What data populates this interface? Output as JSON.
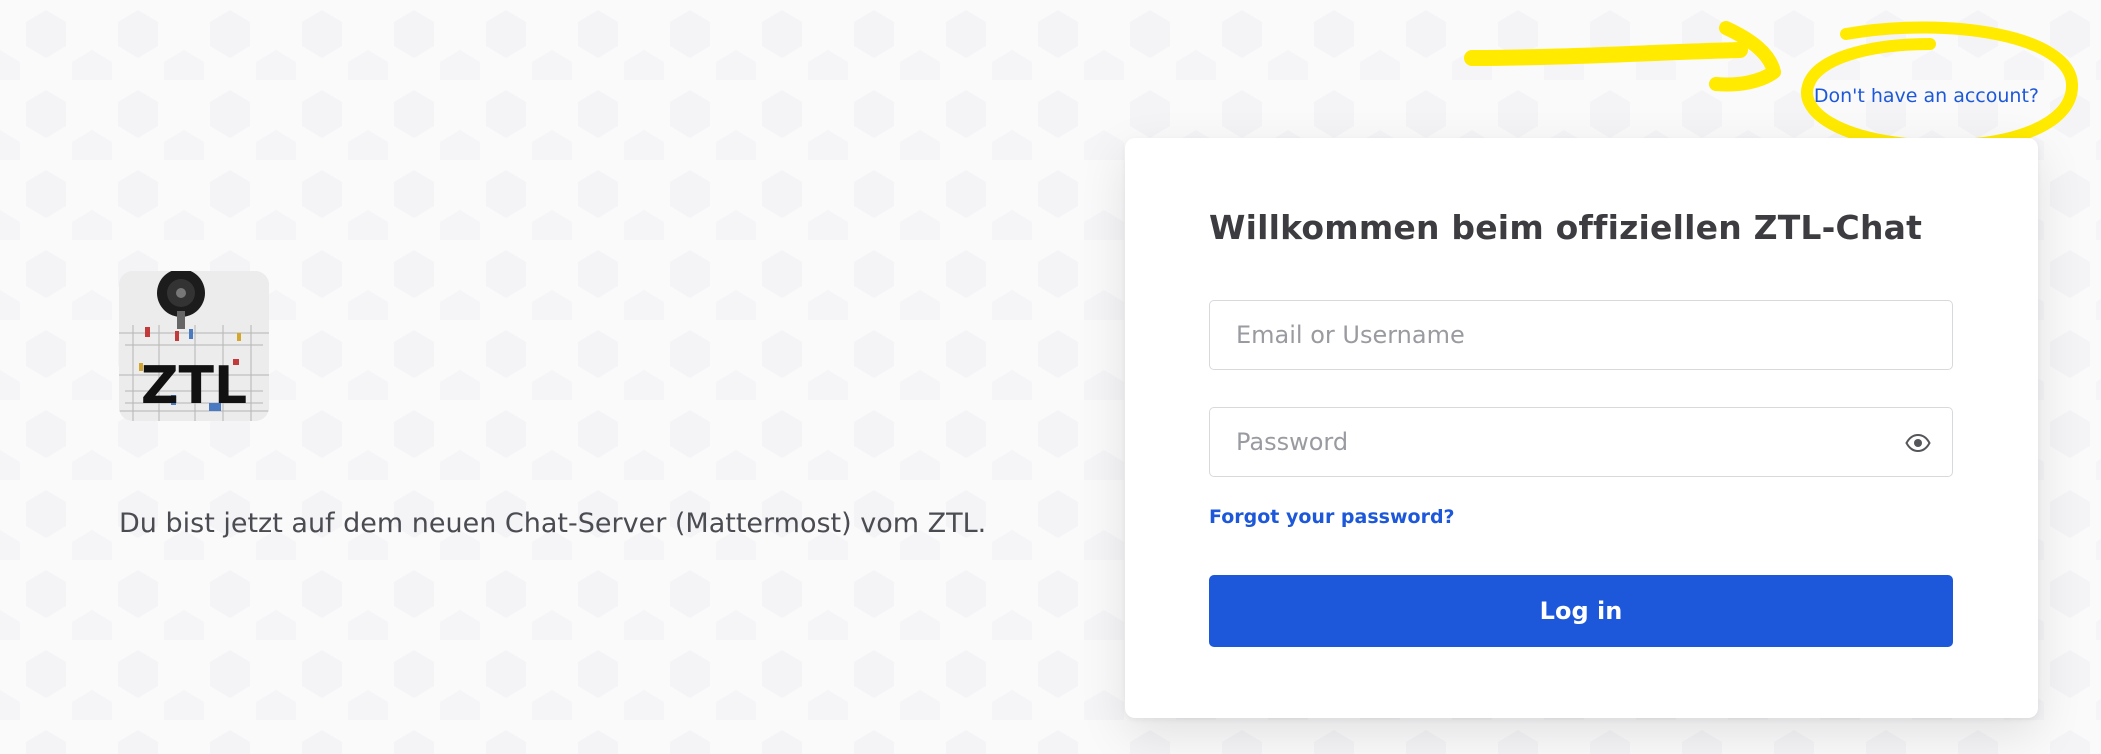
{
  "header": {
    "signup_link": "Don't have an account?"
  },
  "brand": {
    "logo_text": "ZTL",
    "tagline": "Du bist jetzt auf dem neuen Chat-Server (Mattermost) vom ZTL."
  },
  "login": {
    "title": "Willkommen beim offiziellen ZTL-Chat",
    "username_placeholder": "Email or Username",
    "password_placeholder": "Password",
    "forgot_password": "Forgot your password?",
    "submit_label": "Log in"
  },
  "icons": {
    "password_toggle": "eye-icon"
  },
  "colors": {
    "accent": "#1c58d9",
    "annotation": "#ffea00",
    "background": "#fafafb"
  }
}
